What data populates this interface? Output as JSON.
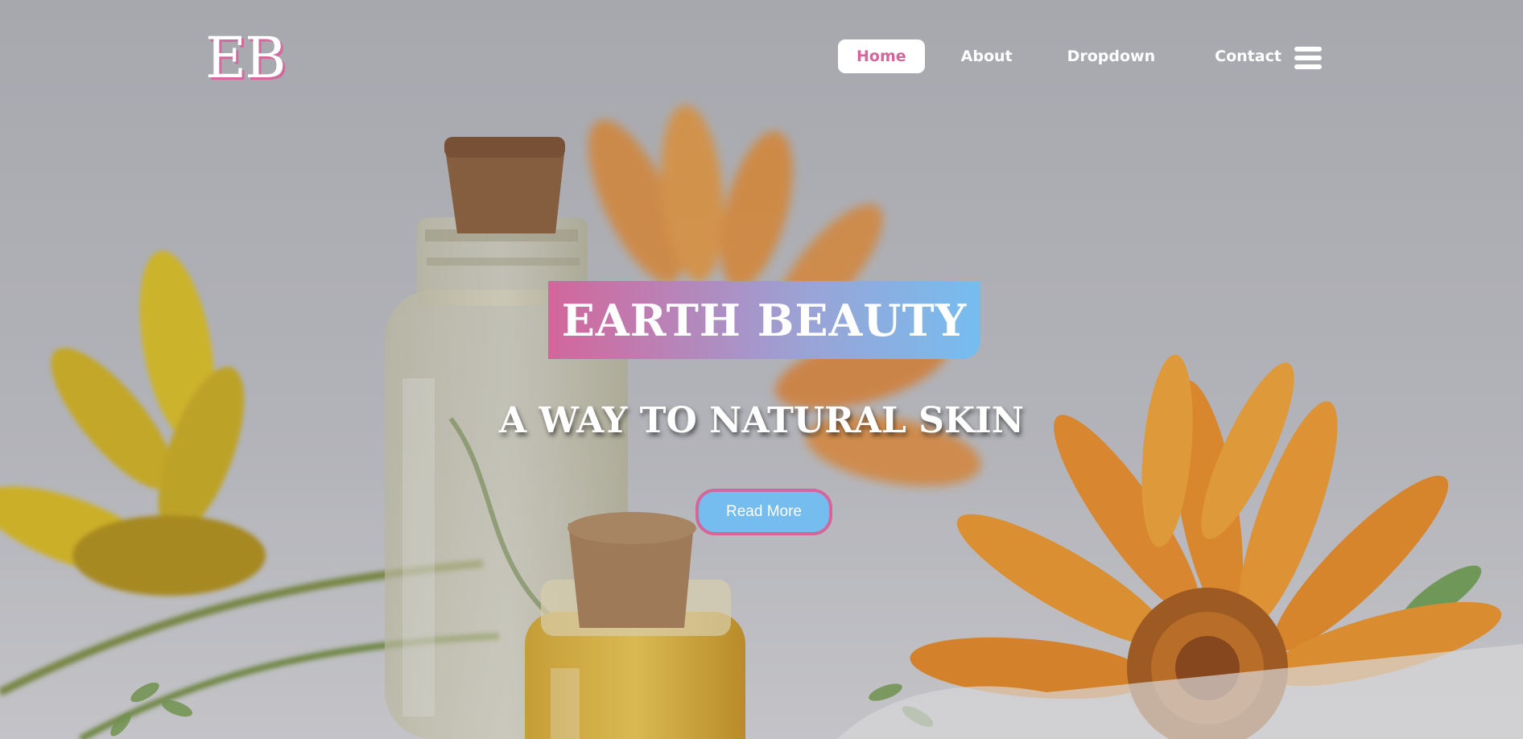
{
  "brand": {
    "logo_text": "EB"
  },
  "nav": {
    "items": [
      {
        "label": "Home",
        "active": true
      },
      {
        "label": "About",
        "active": false
      },
      {
        "label": "Dropdown",
        "active": false
      },
      {
        "label": "Contact",
        "active": false
      }
    ],
    "menu_icon": "hamburger-icon"
  },
  "hero": {
    "title": "EARTH BEAUTY",
    "subtitle": "A WAY TO NATURAL SKIN",
    "cta_label": "Read More",
    "background_image": "essential-oil-bottles-with-flowers-photo"
  },
  "colors": {
    "accent_pink": "#d3669b",
    "accent_blue": "#75bdef",
    "text": "#ffffff"
  }
}
